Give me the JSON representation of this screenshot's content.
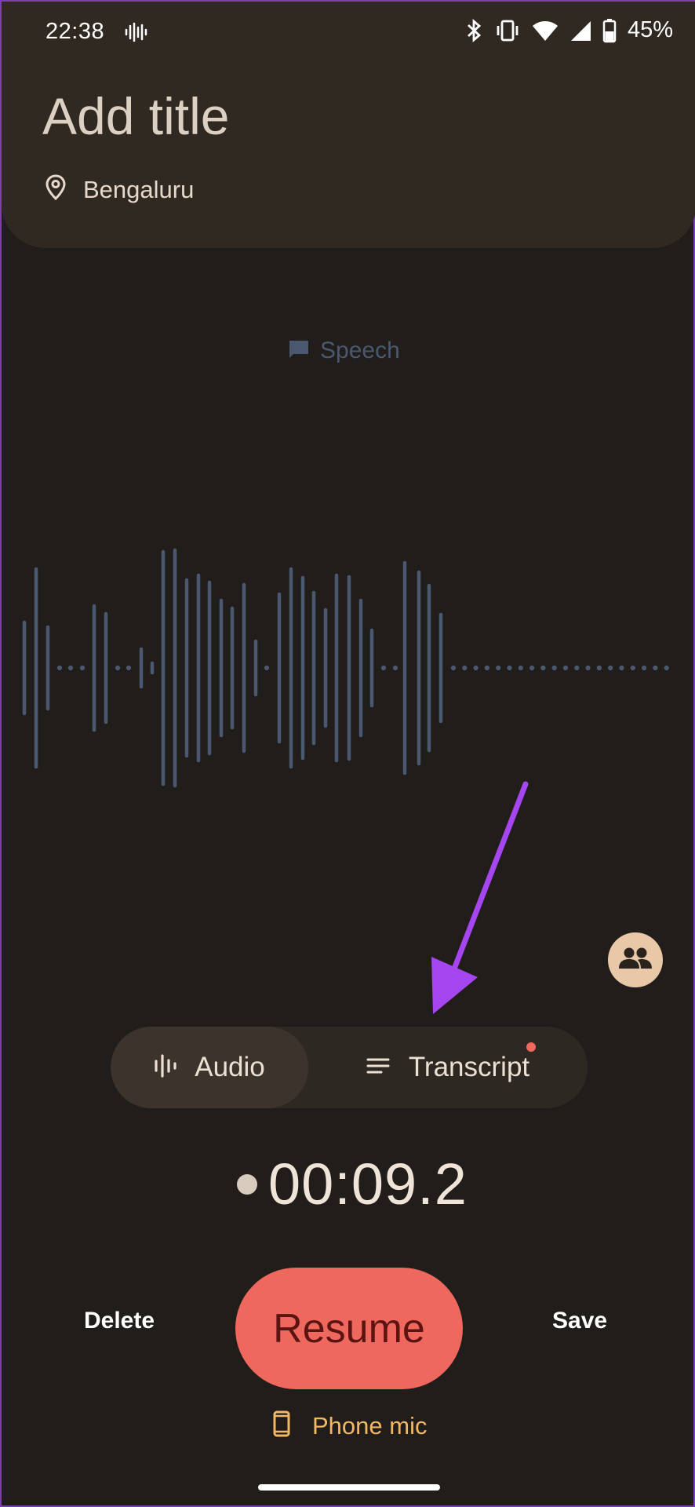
{
  "status_bar": {
    "time": "22:38",
    "battery": "45%",
    "icons": [
      "sound-wave-icon",
      "bluetooth-icon",
      "vibrate-icon",
      "wifi-icon",
      "signal-icon",
      "battery-icon"
    ]
  },
  "header": {
    "title": "Add title",
    "location": "Bengaluru"
  },
  "waveform": {
    "label": "Speech",
    "icons": [
      "speech-bubble-icon"
    ]
  },
  "tabs": {
    "audio_label": "Audio",
    "transcript_label": "Transcript",
    "active": "Audio"
  },
  "recording": {
    "timer": "00:09.2"
  },
  "controls": {
    "delete_label": "Delete",
    "resume_label": "Resume",
    "save_label": "Save",
    "mic_label": "Phone mic"
  },
  "colors": {
    "background": "#201d1a",
    "header": "#302922",
    "resume": "#ef685e",
    "mic_accent": "#f2b866",
    "waveform": "#4a5870",
    "annotation_arrow": "#a646f0"
  }
}
